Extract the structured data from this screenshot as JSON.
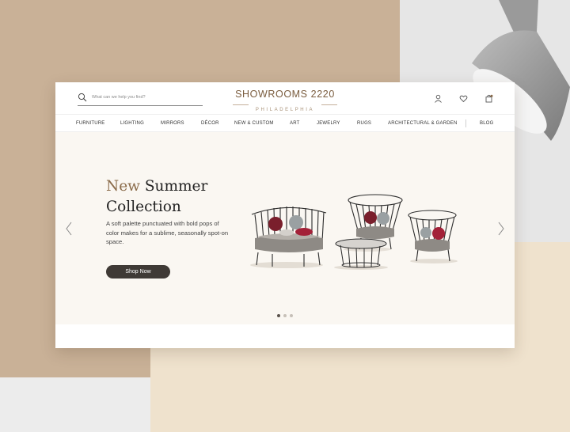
{
  "search": {
    "placeholder": "What can we help you find?"
  },
  "logo": {
    "main": "SHOWROOMS 2220",
    "sub": "PHILADELPHIA"
  },
  "header_icons": [
    "user-icon",
    "heart-icon",
    "shopping-bag-icon"
  ],
  "nav": {
    "items": [
      "FURNITURE",
      "LIGHTING",
      "MIRRORS",
      "DÉCOR",
      "NEW & CUSTOM",
      "ART",
      "JEWELRY",
      "RUGS",
      "ARCHITECTURAL & GARDEN",
      "BLOG"
    ]
  },
  "hero": {
    "title_accent": "New",
    "title_rest": " Summer Collection",
    "body": "A soft palette punctuated with bold pops of color makes for a sublime, seasonally spot-on space.",
    "cta_label": "Shop Now",
    "slide_count": 3,
    "active_slide": 1
  },
  "colors": {
    "backdrop_tan": "#c9b197",
    "backdrop_cream": "#efe2cd",
    "brand_brown": "#7a5c3e",
    "accent_brown": "#8b6c4b",
    "cta_dark": "#3f3a36",
    "hero_bg": "#faf7f2"
  }
}
